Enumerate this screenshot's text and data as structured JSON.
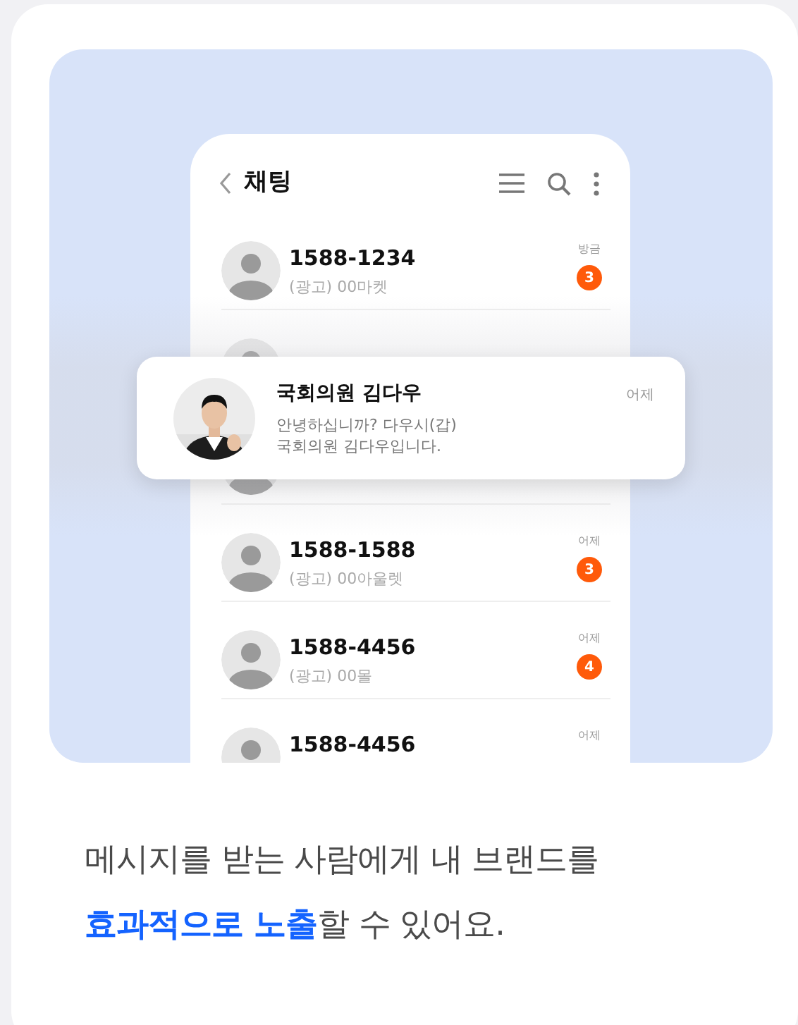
{
  "phone": {
    "title": "채팅",
    "chats": [
      {
        "kind": "chat",
        "title": "1588-1234",
        "subtitle": "(광고) 00마켓",
        "time": "방금",
        "badge": "3"
      },
      {
        "kind": "covered"
      },
      {
        "kind": "covered"
      },
      {
        "kind": "chat",
        "title": "1588-1588",
        "subtitle": "(광고) 00아울렛",
        "time": "어제",
        "badge": "3"
      },
      {
        "kind": "chat",
        "title": "1588-4456",
        "subtitle": "(광고) 00몰",
        "time": "어제",
        "badge": "4"
      },
      {
        "kind": "chat",
        "title": "1588-4456",
        "time": "어제"
      }
    ]
  },
  "notification": {
    "sender": "국회의원 김다우",
    "time": "어제",
    "message": [
      "안녕하십니까? 다우시(갑)",
      "국회의원 김다우입니다."
    ]
  },
  "caption": [
    "메시지를 받는 사람에게 내 브랜드를",
    "**효과적으로 노출**할 수 있어요."
  ]
}
